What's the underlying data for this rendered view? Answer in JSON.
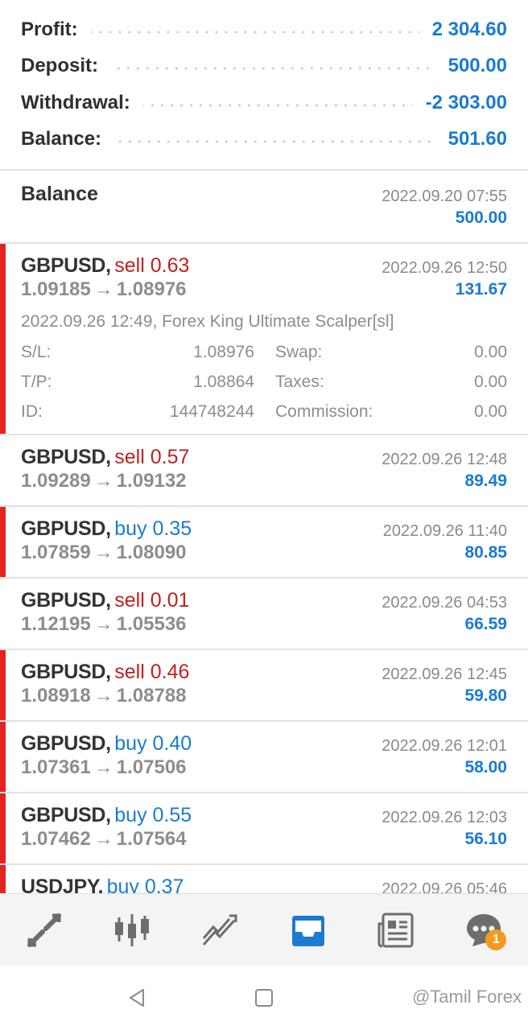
{
  "summary": [
    {
      "label": "Profit:",
      "value": "2 304.60"
    },
    {
      "label": "Deposit:",
      "value": "500.00"
    },
    {
      "label": "Withdrawal:",
      "value": "-2 303.00"
    },
    {
      "label": "Balance:",
      "value": "501.60"
    }
  ],
  "balance_entry": {
    "title": "Balance",
    "time": "2022.09.20 07:55",
    "amount": "500.00"
  },
  "trades": [
    {
      "symbol": "GBPUSD,",
      "direction": "sell 0.63",
      "type": "sell",
      "time": "2022.09.26 12:50",
      "open": "1.09185",
      "arrow": "→",
      "close": "1.08976",
      "profit": "131.67",
      "details": {
        "comment": "2022.09.26 12:49, Forex King Ultimate Scalper[sl]",
        "sl_label": "S/L:",
        "sl": "1.08976",
        "tp_label": "T/P:",
        "tp": "1.08864",
        "id_label": "ID:",
        "id": "144748244",
        "swap_label": "Swap:",
        "swap": "0.00",
        "taxes_label": "Taxes:",
        "taxes": "0.00",
        "commission_label": "Commission:",
        "commission": "0.00"
      }
    },
    {
      "symbol": "GBPUSD,",
      "direction": "sell 0.57",
      "type": "sell",
      "time": "2022.09.26 12:48",
      "open": "1.09289",
      "arrow": "→",
      "close": "1.09132",
      "profit": "89.49"
    },
    {
      "symbol": "GBPUSD,",
      "direction": "buy 0.35",
      "type": "buy",
      "time": "2022.09.26 11:40",
      "open": "1.07859",
      "arrow": "→",
      "close": "1.08090",
      "profit": "80.85"
    },
    {
      "symbol": "GBPUSD,",
      "direction": "sell 0.01",
      "type": "sell",
      "time": "2022.09.26 04:53",
      "open": "1.12195",
      "arrow": "→",
      "close": "1.05536",
      "profit": "66.59"
    },
    {
      "symbol": "GBPUSD,",
      "direction": "sell 0.46",
      "type": "sell",
      "time": "2022.09.26 12:45",
      "open": "1.08918",
      "arrow": "→",
      "close": "1.08788",
      "profit": "59.80"
    },
    {
      "symbol": "GBPUSD,",
      "direction": "buy 0.40",
      "type": "buy",
      "time": "2022.09.26 12:01",
      "open": "1.07361",
      "arrow": "→",
      "close": "1.07506",
      "profit": "58.00"
    },
    {
      "symbol": "GBPUSD,",
      "direction": "buy 0.55",
      "type": "buy",
      "time": "2022.09.26 12:03",
      "open": "1.07462",
      "arrow": "→",
      "close": "1.07564",
      "profit": "56.10"
    },
    {
      "symbol": "USDJPY,",
      "direction": "buy 0.37",
      "type": "buy",
      "time": "2022.09.26 05:46"
    }
  ],
  "nav": {
    "items": [
      "trade-icon",
      "quotes-candles-icon",
      "chart-icon",
      "history-inbox-icon",
      "news-icon",
      "chat-icon"
    ],
    "chat_badge": "1",
    "active_color": "#1a7bd1"
  },
  "watermark": "@Tamil Forex",
  "colors": {
    "blue": "#1a7bd1",
    "red": "#c0201f",
    "marker": "#e52222"
  }
}
